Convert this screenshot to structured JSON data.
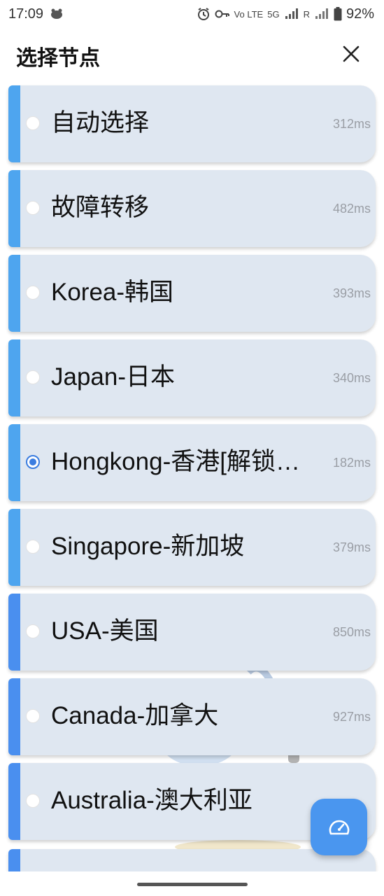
{
  "status_bar": {
    "time": "17:09",
    "volte": "Vo LTE",
    "network": "5G",
    "roaming": "R",
    "battery": "92%"
  },
  "header": {
    "title": "选择节点"
  },
  "nodes": [
    {
      "name": "自动选择",
      "latency": "312ms",
      "selected": false,
      "bar_color": "#4ea5ef"
    },
    {
      "name": "故障转移",
      "latency": "482ms",
      "selected": false,
      "bar_color": "#4ea5ef"
    },
    {
      "name": "Korea-韩国",
      "latency": "393ms",
      "selected": false,
      "bar_color": "#4ea5ef"
    },
    {
      "name": "Japan-日本",
      "latency": "340ms",
      "selected": false,
      "bar_color": "#4ea5ef"
    },
    {
      "name": "Hongkong-香港[解锁…",
      "latency": "182ms",
      "selected": true,
      "bar_color": "#4ea5ef"
    },
    {
      "name": "Singapore-新加坡",
      "latency": "379ms",
      "selected": false,
      "bar_color": "#4ea5ef"
    },
    {
      "name": "USA-美国",
      "latency": "850ms",
      "selected": false,
      "bar_color": "#4a8fef"
    },
    {
      "name": "Canada-加拿大",
      "latency": "927ms",
      "selected": false,
      "bar_color": "#4a8fef"
    },
    {
      "name": "Australia-澳大利亚",
      "latency": "",
      "selected": false,
      "bar_color": "#4a8fef"
    },
    {
      "name": "",
      "latency": "",
      "selected": false,
      "bar_color": "#4a8fef"
    }
  ],
  "icons": {
    "close": "close-icon",
    "fab": "speedometer-icon",
    "alarm": "alarm-icon",
    "vpn_key": "key-icon",
    "signal": "signal-icon",
    "battery": "battery-icon"
  },
  "colors": {
    "accent": "#4a96ef",
    "card_bg": "#dfe7f1",
    "radio_selected": "#3b7de0"
  }
}
